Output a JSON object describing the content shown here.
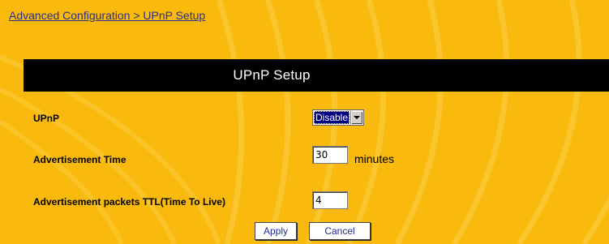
{
  "breadcrumb": "Advanced Configuration > UPnP Setup",
  "header": {
    "title": "UPnP Setup"
  },
  "fields": {
    "upnp": {
      "label": "UPnP",
      "value": "Disable"
    },
    "advertisement_time": {
      "label": "Advertisement Time",
      "value": "30",
      "unit": "minutes"
    },
    "ttl": {
      "label": "Advertisement packets TTL(Time To Live)",
      "value": "4"
    }
  },
  "buttons": {
    "apply": "Apply",
    "cancel": "Cancel"
  },
  "colors": {
    "background": "#f9b90d",
    "header_bar": "#000000",
    "header_text": "#ffffff",
    "link": "#2b2f86",
    "button_text": "#1b2a9a",
    "select_highlight": "#000080"
  }
}
